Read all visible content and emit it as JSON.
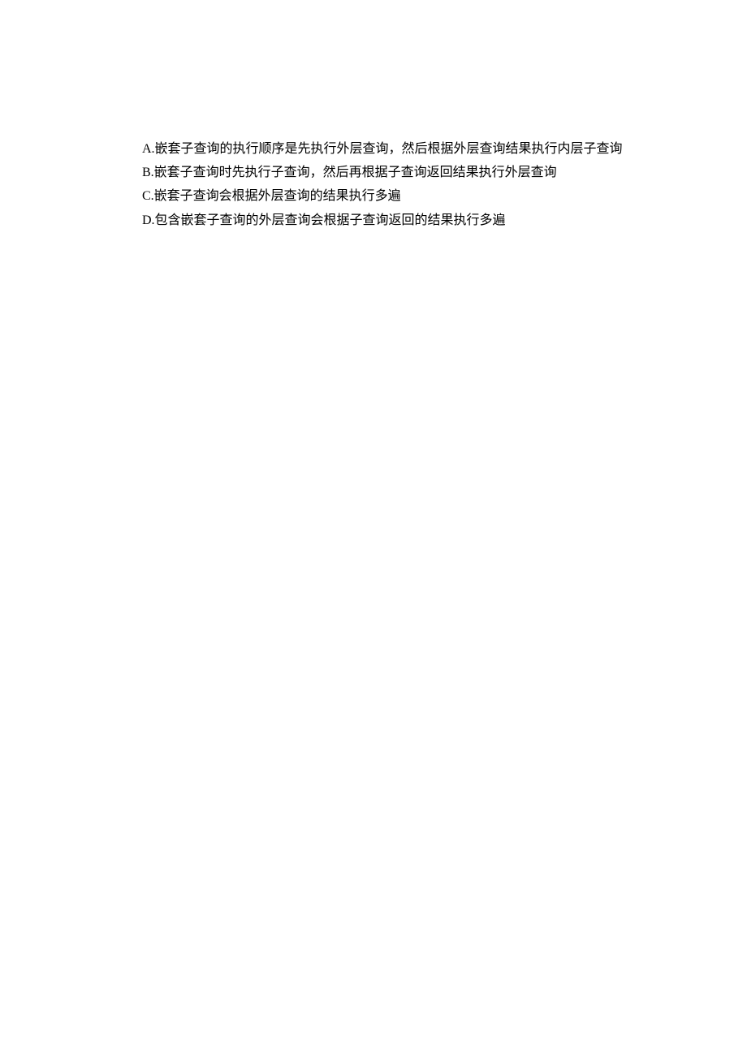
{
  "options": {
    "a": "A.嵌套子查询的执行顺序是先执行外层查询，然后根据外层查询结果执行内层子查询",
    "b": "B.嵌套子查询时先执行子查询，然后再根据子查询返回结果执行外层查询",
    "c": "C.嵌套子查询会根据外层查询的结果执行多遍",
    "d": "D.包含嵌套子查询的外层查询会根据子查询返回的结果执行多遍"
  }
}
